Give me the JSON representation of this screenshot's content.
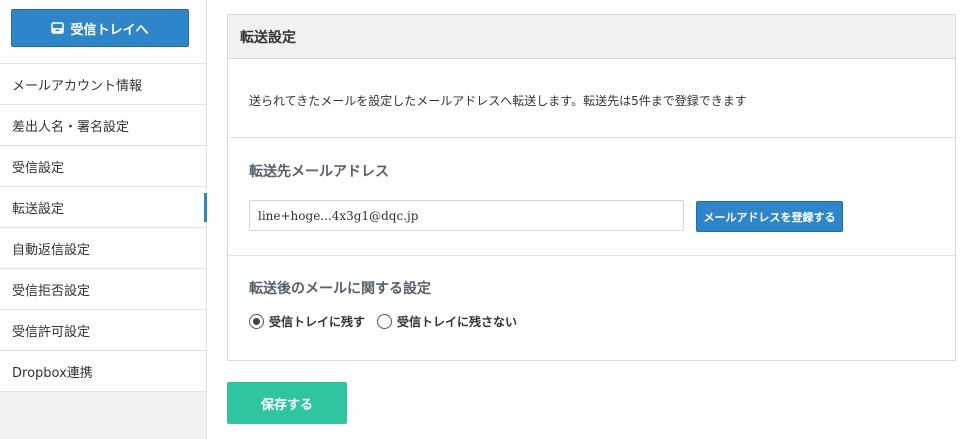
{
  "sidebar": {
    "inbox_button": {
      "label": "受信トレイへ",
      "icon": "inbox-icon"
    },
    "items": [
      {
        "label": "メールアカウント情報",
        "active": false
      },
      {
        "label": "差出人名・署名設定",
        "active": false
      },
      {
        "label": "受信設定",
        "active": false
      },
      {
        "label": "転送設定",
        "active": true
      },
      {
        "label": "自動返信設定",
        "active": false
      },
      {
        "label": "受信拒否設定",
        "active": false
      },
      {
        "label": "受信許可設定",
        "active": false
      },
      {
        "label": "Dropbox連携",
        "active": false
      }
    ]
  },
  "panel": {
    "title": "転送設定",
    "description": "送られてきたメールを設定したメールアドレスへ転送します。転送先は5件まで登録できます",
    "forward_section": {
      "title": "転送先メールアドレス",
      "email_value": "line+hoge...4x3g1@dqc.jp",
      "register_label": "メールアドレスを登録する"
    },
    "after_section": {
      "title": "転送後のメールに関する設定",
      "options": [
        {
          "label": "受信トレイに残す",
          "checked": true
        },
        {
          "label": "受信トレイに残さない",
          "checked": false
        }
      ]
    }
  },
  "save_label": "保存する",
  "colors": {
    "primary": "#2e86c8",
    "save": "#2ec5a0",
    "sidebar_bg": "#f2f2f2"
  }
}
